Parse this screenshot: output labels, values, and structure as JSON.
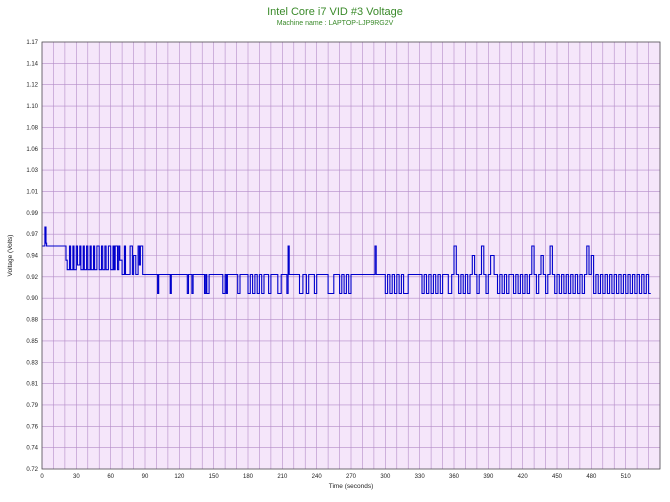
{
  "chart_data": {
    "type": "line",
    "title": "Intel Core i7 VID #3 Voltage",
    "subtitle": "Machine name : LAPTOP-LJP9RG2V",
    "xlabel": "Time (seconds)",
    "ylabel": "Voltage (Volts)",
    "xlim": [
      0,
      540
    ],
    "ylim": [
      0.72,
      1.17
    ],
    "x_ticks": [
      0,
      30,
      60,
      90,
      120,
      150,
      180,
      210,
      240,
      270,
      300,
      330,
      360,
      390,
      420,
      450,
      480,
      510
    ],
    "y_ticks": [
      "0.72",
      "0.74",
      "0.76",
      "0.79",
      "0.81",
      "0.83",
      "0.85",
      "0.88",
      "0.90",
      "0.92",
      "0.94",
      "0.97",
      "0.99",
      "1.01",
      "1.03",
      "1.06",
      "1.08",
      "1.10",
      "1.12",
      "1.14",
      "1.17"
    ],
    "grid": true,
    "colors": {
      "background": "#f5e6fa",
      "grid": "#b48cc8",
      "line": "#0000cc",
      "title": "#3a8a2a"
    },
    "series": [
      {
        "values_x": [
          0,
          2,
          2.5,
          3.5,
          4,
          20,
          21,
          22,
          24,
          25,
          27,
          28,
          30,
          31,
          33,
          34,
          36,
          37,
          39,
          40,
          42,
          43,
          45,
          46,
          48,
          50,
          52,
          53,
          55,
          56,
          58,
          60,
          62,
          63,
          64,
          66,
          67,
          68,
          70,
          72,
          73,
          75,
          77,
          79,
          80,
          82,
          84,
          85,
          86,
          88,
          90,
          91,
          92,
          96,
          100,
          101,
          102,
          103,
          104,
          110,
          112,
          113,
          114,
          116,
          120,
          125,
          127,
          128,
          130,
          131,
          132,
          134,
          140,
          142,
          143,
          144,
          146,
          148,
          150,
          155,
          158,
          160,
          161,
          162,
          164,
          168,
          170,
          171,
          173,
          175,
          178,
          180,
          182,
          184,
          186,
          188,
          190,
          192,
          194,
          196,
          198,
          200,
          203,
          206,
          209,
          212,
          214,
          215,
          216,
          218,
          220,
          225,
          228,
          230,
          231,
          233,
          235,
          238,
          240,
          245,
          250,
          255,
          258,
          260,
          262,
          264,
          266,
          268,
          270,
          275,
          280,
          285,
          290,
          291,
          292,
          295,
          300,
          302,
          304,
          306,
          308,
          310,
          312,
          314,
          316,
          320,
          330,
          332,
          334,
          336,
          338,
          340,
          342,
          344,
          346,
          348,
          350,
          355,
          358,
          360,
          362,
          364,
          366,
          368,
          370,
          372,
          374,
          376,
          378,
          380,
          382,
          384,
          386,
          388,
          390,
          392,
          395,
          398,
          400,
          402,
          404,
          406,
          408,
          410,
          412,
          414,
          416,
          418,
          420,
          422,
          424,
          426,
          428,
          430,
          432,
          434,
          436,
          438,
          440,
          442,
          444,
          446,
          448,
          450,
          452,
          454,
          456,
          458,
          460,
          462,
          464,
          466,
          468,
          470,
          472,
          474,
          476,
          478,
          480,
          482,
          484,
          486,
          488,
          490,
          492,
          494,
          496,
          498,
          500,
          502,
          504,
          506,
          508,
          510,
          512,
          514,
          516,
          518,
          520,
          522,
          524,
          526,
          528,
          530,
          532,
          534,
          536,
          538,
          540
        ],
        "values_y": [
          0.955,
          0.955,
          0.975,
          0.958,
          0.955,
          0.955,
          0.94,
          0.93,
          0.955,
          0.93,
          0.955,
          0.93,
          0.955,
          0.935,
          0.955,
          0.93,
          0.955,
          0.93,
          0.955,
          0.93,
          0.955,
          0.93,
          0.955,
          0.93,
          0.955,
          0.93,
          0.955,
          0.93,
          0.955,
          0.93,
          0.955,
          0.93,
          0.955,
          0.93,
          0.955,
          0.93,
          0.955,
          0.94,
          0.925,
          0.955,
          0.925,
          0.925,
          0.955,
          0.925,
          0.945,
          0.925,
          0.955,
          0.935,
          0.955,
          0.925,
          0.925,
          0.925,
          0.925,
          0.925,
          0.925,
          0.905,
          0.925,
          0.925,
          0.925,
          0.925,
          0.905,
          0.925,
          0.925,
          0.925,
          0.925,
          0.925,
          0.905,
          0.925,
          0.925,
          0.905,
          0.925,
          0.925,
          0.925,
          0.905,
          0.925,
          0.905,
          0.925,
          0.925,
          0.925,
          0.925,
          0.905,
          0.925,
          0.905,
          0.925,
          0.925,
          0.925,
          0.925,
          0.905,
          0.925,
          0.925,
          0.925,
          0.905,
          0.925,
          0.905,
          0.925,
          0.905,
          0.925,
          0.905,
          0.925,
          0.925,
          0.905,
          0.925,
          0.925,
          0.905,
          0.925,
          0.925,
          0.905,
          0.955,
          0.925,
          0.925,
          0.925,
          0.905,
          0.925,
          0.925,
          0.905,
          0.925,
          0.925,
          0.905,
          0.925,
          0.925,
          0.905,
          0.925,
          0.925,
          0.905,
          0.925,
          0.905,
          0.925,
          0.905,
          0.925,
          0.925,
          0.925,
          0.925,
          0.925,
          0.955,
          0.925,
          0.925,
          0.905,
          0.925,
          0.905,
          0.925,
          0.905,
          0.925,
          0.905,
          0.925,
          0.905,
          0.925,
          0.925,
          0.905,
          0.925,
          0.905,
          0.925,
          0.905,
          0.925,
          0.905,
          0.925,
          0.905,
          0.925,
          0.905,
          0.925,
          0.955,
          0.925,
          0.905,
          0.925,
          0.905,
          0.925,
          0.905,
          0.925,
          0.945,
          0.925,
          0.905,
          0.925,
          0.955,
          0.925,
          0.905,
          0.925,
          0.945,
          0.925,
          0.905,
          0.925,
          0.905,
          0.925,
          0.905,
          0.925,
          0.925,
          0.905,
          0.925,
          0.905,
          0.925,
          0.905,
          0.925,
          0.905,
          0.925,
          0.955,
          0.925,
          0.905,
          0.925,
          0.945,
          0.925,
          0.905,
          0.925,
          0.955,
          0.925,
          0.905,
          0.925,
          0.905,
          0.925,
          0.905,
          0.925,
          0.905,
          0.925,
          0.905,
          0.925,
          0.905,
          0.925,
          0.905,
          0.925,
          0.955,
          0.925,
          0.945,
          0.905,
          0.925,
          0.905,
          0.925,
          0.905,
          0.925,
          0.905,
          0.925,
          0.905,
          0.925,
          0.905,
          0.925,
          0.905,
          0.925,
          0.905,
          0.925,
          0.905,
          0.925,
          0.905,
          0.925,
          0.905,
          0.925,
          0.905,
          0.925,
          0.905
        ]
      }
    ]
  }
}
